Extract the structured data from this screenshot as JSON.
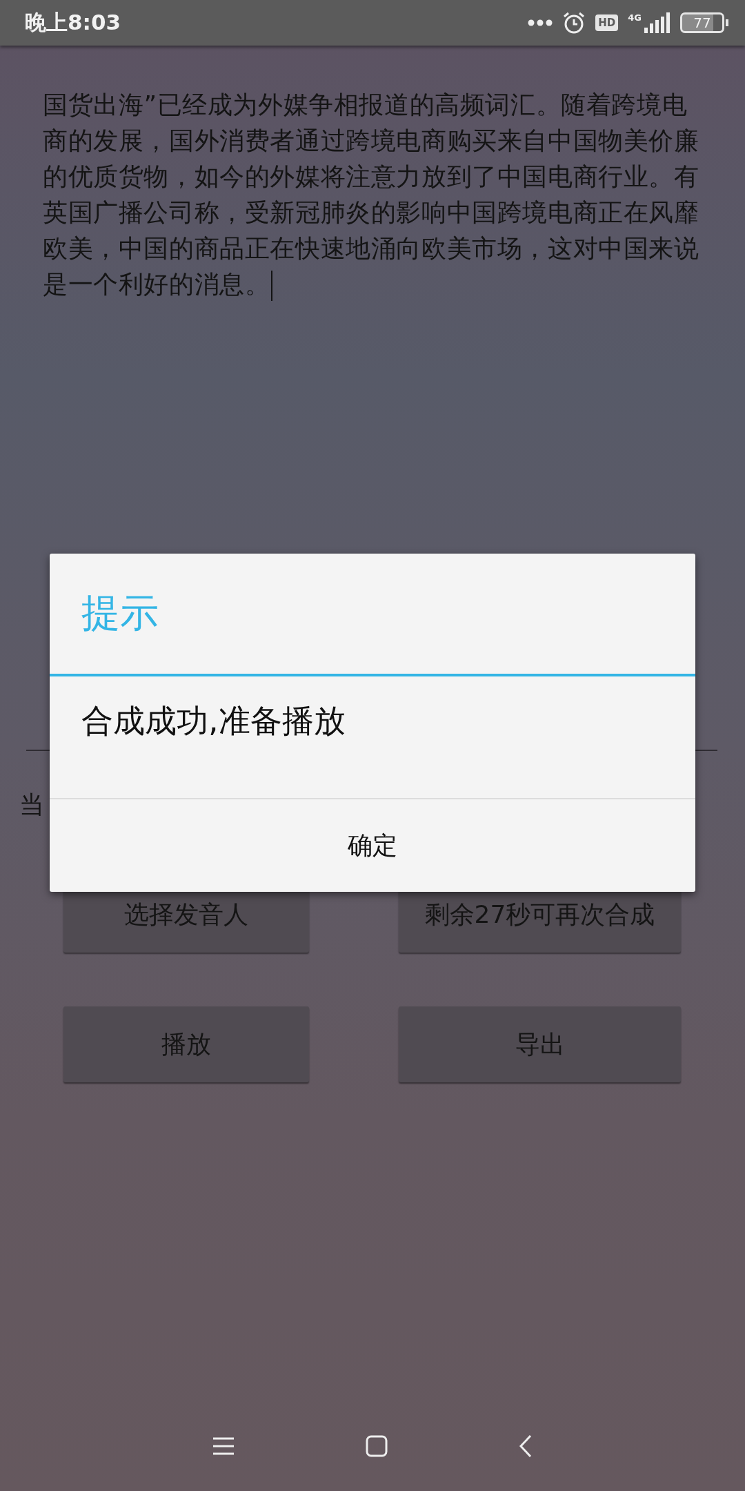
{
  "status_bar": {
    "time": "晚上8:03",
    "hd_badge": "HD",
    "network": "4G",
    "battery": "77"
  },
  "text_field": {
    "value": "国货出海”已经成为外媒争相报道的高频词汇。随着跨境电商的发展，国外消费者通过跨境电商购买来自中国物美价廉的优质货物，如今的外媒将注意力放到了中国电商行业。有英国广播公司称，受新冠肺炎的影响中国跨境电商正在风靡欧美，中国的商品正在快速地涌向欧美市场，这对中国来说是一个利好的消息。"
  },
  "label": "当",
  "buttons": [
    {
      "label": "选择发音人"
    },
    {
      "label": "剩余27秒可再次合成"
    },
    {
      "label": "播放"
    },
    {
      "label": "导出"
    }
  ],
  "dialog": {
    "title": "提示",
    "message": "合成成功,准备播放",
    "buttons": [
      "确定"
    ]
  }
}
